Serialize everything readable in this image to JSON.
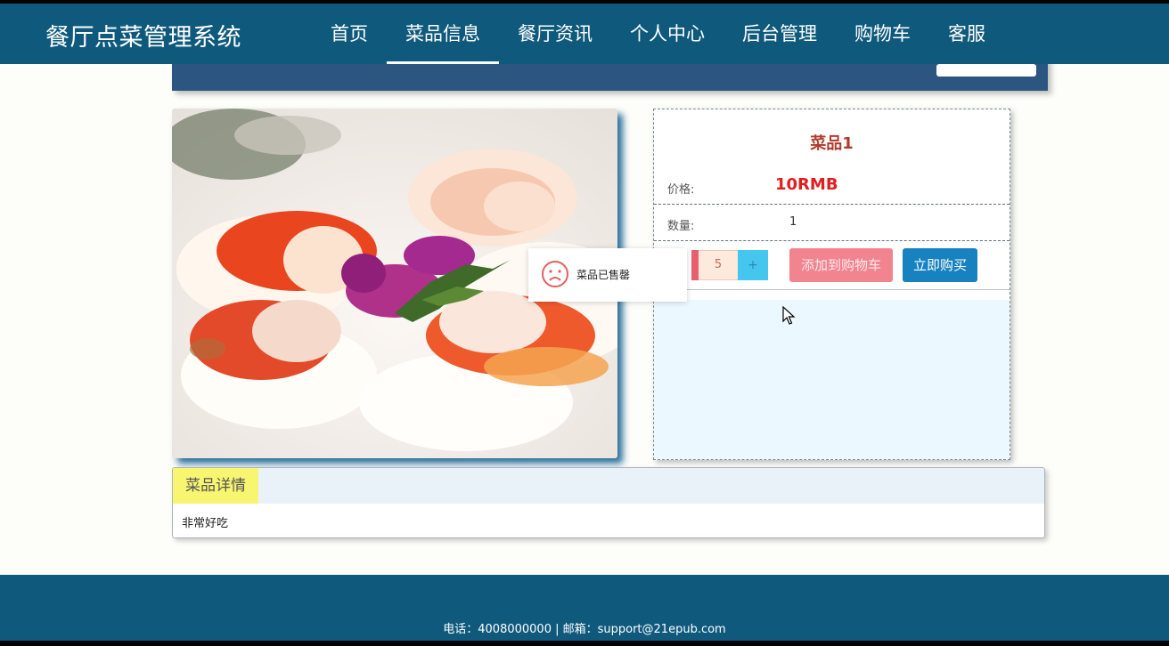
{
  "header": {
    "brand": "餐厅点菜管理系统",
    "nav": [
      "首页",
      "菜品信息",
      "餐厅资讯",
      "个人中心",
      "后台管理",
      "购物车",
      "客服"
    ]
  },
  "product": {
    "title": "菜品1",
    "price_label": "价格:",
    "price": "10RMB",
    "quantity_label": "数量:",
    "quantity": "1",
    "stepper_value": "5",
    "stepper_inc": "+",
    "add_to_cart": "添加到购物车",
    "buy_now": "立即购买"
  },
  "toast": {
    "icon": "sad-face-icon",
    "text": "菜品已售罄"
  },
  "detail": {
    "tab": "菜品详情",
    "content": "非常好吃"
  },
  "footer": {
    "text": "电话：4008000000 | 邮箱：support@21epub.com"
  },
  "colors": {
    "nav_bg": "#0f5a7c",
    "price": "#e01e1e",
    "cart_button": "#f1848f",
    "buy_button": "#1881bf",
    "tab_highlight": "#f8f571"
  }
}
